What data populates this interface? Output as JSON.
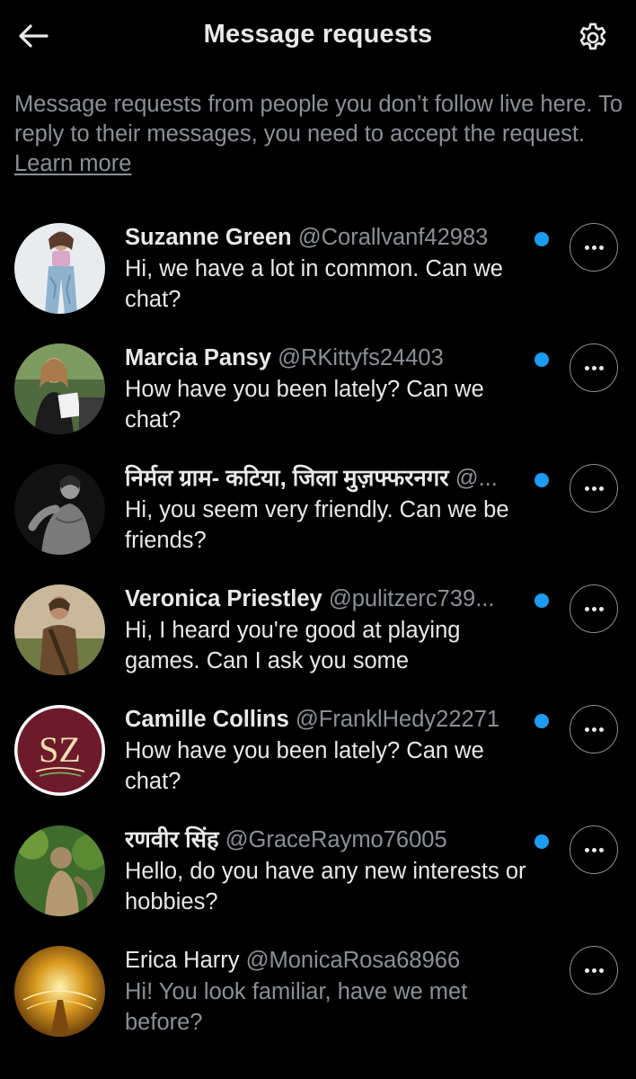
{
  "header": {
    "title": "Message requests",
    "back_icon": "arrow-left-icon",
    "settings_icon": "gear-icon"
  },
  "intro": {
    "text": "Message requests from people you don’t follow live here. To reply to their messages, you need to accept the request.",
    "link": "Learn more"
  },
  "colors": {
    "background": "#000000",
    "accent": "#1d9bf0",
    "muted_text": "#8b9097",
    "primary_text": "#e7e9ea"
  },
  "requests": [
    {
      "name": "Suzanne Green",
      "handle": "@Corallvanf42983",
      "message": "Hi, we have a lot in common. Can we chat?",
      "unread": true
    },
    {
      "name": "Marcia Pansy",
      "handle": "@RKittyfs24403",
      "message": "How have you been lately? Can we chat?",
      "unread": true
    },
    {
      "name": "निर्मल ग्राम- कटिया, जिला मुज़फ्फरनगर",
      "handle": "@...",
      "message": "Hi, you seem very friendly. Can we be friends?",
      "unread": true
    },
    {
      "name": "Veronica Priestley",
      "handle": "@pulitzerc739...",
      "message": "Hi, I heard you're good at playing games. Can I ask you some",
      "unread": true
    },
    {
      "name": "Camille Collins",
      "handle": "@FranklHedy22271",
      "message": "How have you been lately? Can we chat?",
      "unread": true,
      "avatar_text": "SZ"
    },
    {
      "name": "रणवीर सिंह",
      "handle": "@GraceRaymo76005",
      "message": "Hello, do you have any new interests or hobbies?",
      "unread": true
    },
    {
      "name": "Erica Harry",
      "handle": "@MonicaRosa68966",
      "message": "Hi! You look familiar, have we met before?",
      "unread": false
    }
  ]
}
